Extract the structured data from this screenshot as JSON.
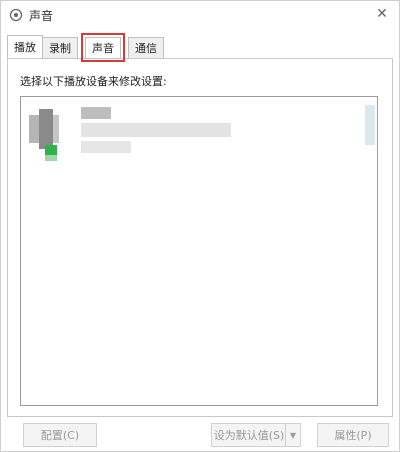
{
  "window": {
    "title": "声音",
    "close_glyph": "✕"
  },
  "tabs": [
    {
      "label": "播放"
    },
    {
      "label": "录制"
    },
    {
      "label": "声音"
    },
    {
      "label": "通信"
    }
  ],
  "panel": {
    "instruction": "选择以下播放设备来修改设置:"
  },
  "buttons": {
    "configure": "配置(C)",
    "set_default": "设为默认值(S)",
    "dropdown_glyph": "▼",
    "properties": "属性(P)"
  },
  "colors": {
    "highlight_box": "#d93a36",
    "default_check": "#2fb24a"
  }
}
